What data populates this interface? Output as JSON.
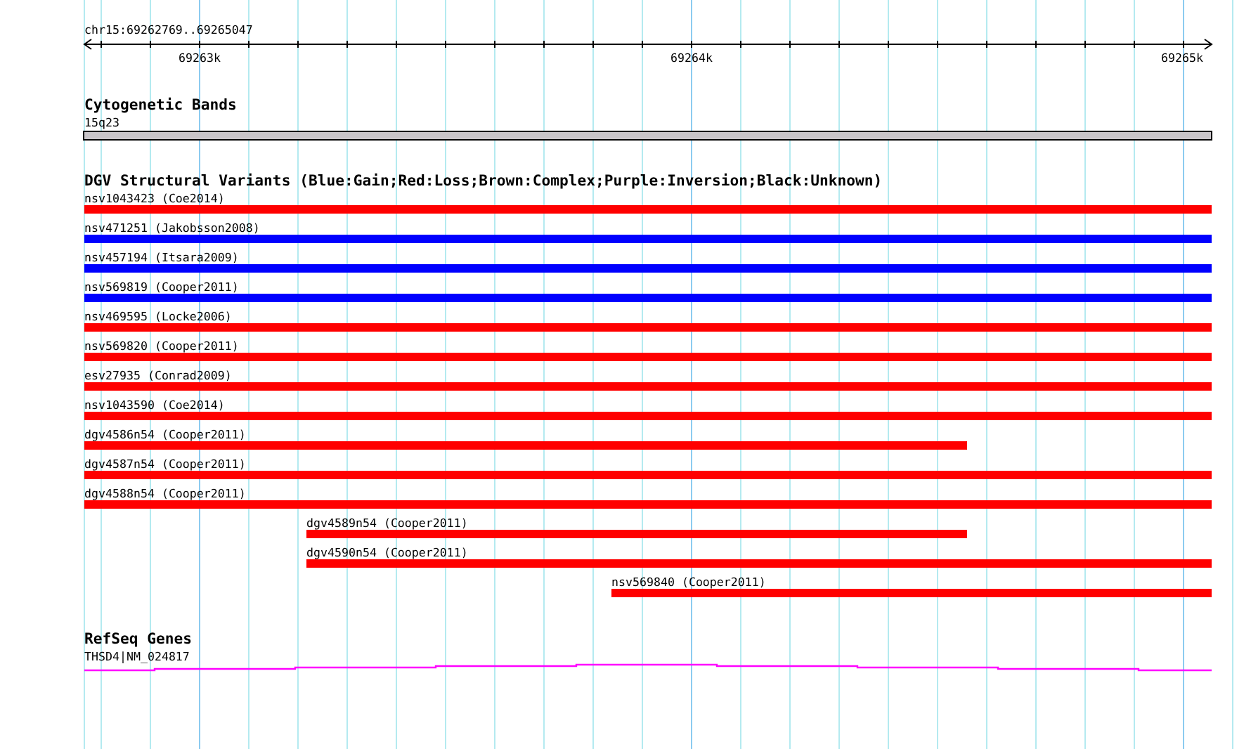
{
  "ruler": {
    "title": "chr15:69262769..69265047",
    "tick_labels": [
      "69263k",
      "69264k",
      "69265k"
    ]
  },
  "cytogenetic_bands": {
    "title": "Cytogenetic Bands",
    "band": "15q23"
  },
  "dgv_track": {
    "title": "DGV Structural Variants (Blue:Gain;Red:Loss;Brown:Complex;Purple:Inversion;Black:Unknown)",
    "variants": [
      {
        "label": "nsv1043423 (Coe2014)",
        "color": "#ff0000"
      },
      {
        "label": "nsv471251 (Jakobsson2008)",
        "color": "#0000ff"
      },
      {
        "label": "nsv457194 (Itsara2009)",
        "color": "#0000ff"
      },
      {
        "label": "nsv569819 (Cooper2011)",
        "color": "#0000ff"
      },
      {
        "label": "nsv469595 (Locke2006)",
        "color": "#ff0000"
      },
      {
        "label": "nsv569820 (Cooper2011)",
        "color": "#ff0000"
      },
      {
        "label": "esv27935 (Conrad2009)",
        "color": "#ff0000"
      },
      {
        "label": "nsv1043590 (Coe2014)",
        "color": "#ff0000"
      },
      {
        "label": "dgv4586n54 (Cooper2011)",
        "color": "#ff0000"
      },
      {
        "label": "dgv4587n54 (Cooper2011)",
        "color": "#ff0000"
      },
      {
        "label": "dgv4588n54 (Cooper2011)",
        "color": "#ff0000"
      },
      {
        "label": "dgv4589n54 (Cooper2011)",
        "color": "#ff0000"
      },
      {
        "label": "dgv4590n54 (Cooper2011)",
        "color": "#ff0000"
      },
      {
        "label": "nsv569840 (Cooper2011)",
        "color": "#ff0000"
      }
    ]
  },
  "refseq_track": {
    "title": "RefSeq Genes",
    "gene": "THSD4|NM_024817"
  }
}
